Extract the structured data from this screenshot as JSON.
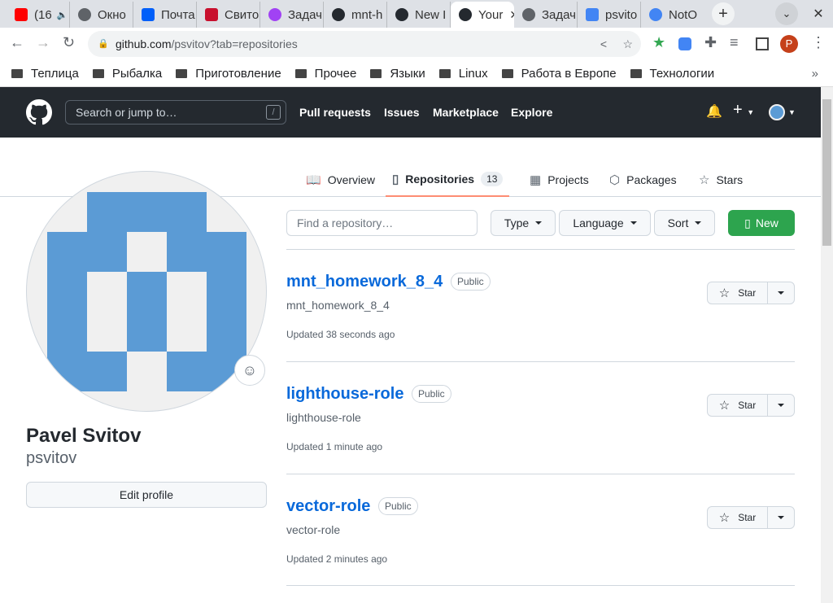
{
  "browser": {
    "tabs": [
      {
        "label": "(16",
        "color": "#ff0000"
      },
      {
        "label": "Окно",
        "color": "#5f6368"
      },
      {
        "label": "Почта",
        "color": "#005ff9"
      },
      {
        "label": "Свито",
        "color": "#c8102e"
      },
      {
        "label": "Задач",
        "color": "#a142f4"
      },
      {
        "label": "mnt-h",
        "color": "#24292f"
      },
      {
        "label": "New I",
        "color": "#24292f"
      },
      {
        "label": "Your",
        "color": "#24292f"
      },
      {
        "label": "Задач",
        "color": "#5f6368"
      },
      {
        "label": "psvito",
        "color": "#4285f4"
      },
      {
        "label": "NotO",
        "color": "#4285f4"
      }
    ],
    "url_host": "github.com",
    "url_path": "/psvitov?tab=repositories",
    "profile_initial": "P",
    "bookmarks": [
      "Теплица",
      "Рыбалка",
      "Приготовление",
      "Прочее",
      "Языки",
      "Linux",
      "Работа в Европе",
      "Технологии"
    ]
  },
  "github": {
    "search_placeholder": "Search or jump to…",
    "slash": "/",
    "nav": [
      "Pull requests",
      "Issues",
      "Marketplace",
      "Explore"
    ],
    "tabs": {
      "overview": "Overview",
      "repositories": "Repositories",
      "repo_count": "13",
      "projects": "Projects",
      "packages": "Packages",
      "stars": "Stars"
    },
    "profile": {
      "name": "Pavel Svitov",
      "login": "psvitov",
      "edit": "Edit profile"
    },
    "filter": {
      "placeholder": "Find a repository…",
      "type": "Type",
      "language": "Language",
      "sort": "Sort",
      "new": "New"
    },
    "repos": [
      {
        "name": "mnt_homework_8_4",
        "visibility": "Public",
        "description": "mnt_homework_8_4",
        "updated": "Updated 38 seconds ago",
        "star": "Star"
      },
      {
        "name": "lighthouse-role",
        "visibility": "Public",
        "description": "lighthouse-role",
        "updated": "Updated 1 minute ago",
        "star": "Star"
      },
      {
        "name": "vector-role",
        "visibility": "Public",
        "description": "vector-role",
        "updated": "Updated 2 minutes ago",
        "star": "Star"
      }
    ]
  }
}
